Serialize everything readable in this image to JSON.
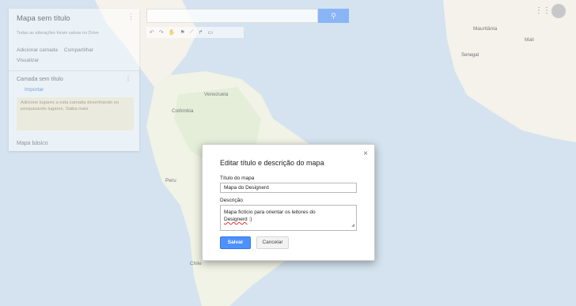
{
  "panel": {
    "title": "Mapa sem título",
    "kebab": "⋮",
    "subtitle": "Todas as alterações foram salvas no Drive",
    "actions": [
      "Adicionar camada",
      "Compartilhar"
    ],
    "preview": "Visualizar",
    "layer": {
      "label": "Camada sem título",
      "import": "Importar"
    },
    "hint": "Adicione lugares a esta camada desenhando ou pesquisando lugares. Saiba mais",
    "base_map": "Mapa básico"
  },
  "toolbar": {
    "search_icon": "search-icon"
  },
  "map_labels": {
    "venezuela": "Venezuela",
    "colombia": "Colômbia",
    "peru": "Peru",
    "chile": "Chile",
    "mauritania": "Mauritânia",
    "mali": "Mali",
    "senegal": "Senegal"
  },
  "dialog": {
    "title": "Editar título e descrição do mapa",
    "close": "×",
    "title_label": "Título do mapa",
    "title_value": "Mapa do Designerd",
    "desc_label": "Descrição",
    "desc_line1": "Mapa fictício para orientar os leitores do",
    "desc_word": "Designerd",
    "desc_tail": " :)",
    "save": "Salvar",
    "cancel": "Cancelar"
  },
  "colors": {
    "accent": "#4d90fe",
    "ocean": "#a6c4dd",
    "land": "#e8e3d6",
    "forest": "#c7dbb0"
  }
}
